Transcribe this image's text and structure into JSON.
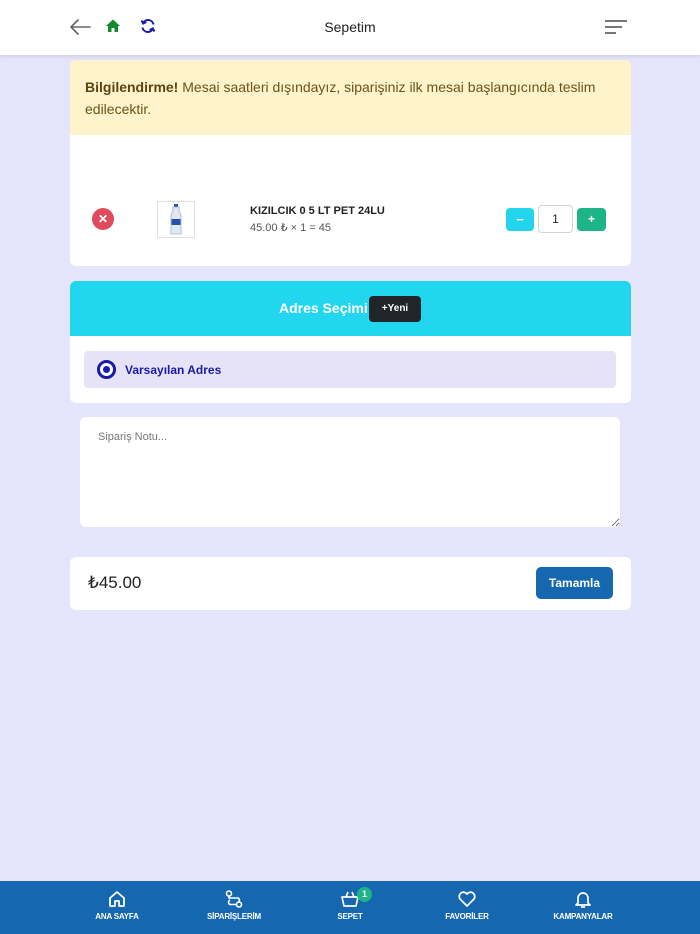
{
  "header": {
    "title": "Sepetim",
    "icons": [
      "arrow-left-icon",
      "home-icon",
      "refresh-icon",
      "menu-icon"
    ]
  },
  "alert": {
    "strong": "Bilgilendirme!",
    "text": "Mesai saatleri dışındayız, siparişiniz ilk mesai başlangıcında teslim edilecektir."
  },
  "cart": {
    "items": [
      {
        "name": "KIZILCIK 0 5 LT PET 24LU",
        "price_line": "45.00 ₺ × 1 = 45",
        "quantity": "1",
        "minus_label": "−",
        "plus_label": "+",
        "remove_label": "✕"
      }
    ]
  },
  "address": {
    "title": "Adres Seçimi",
    "new_button": "+Yeni",
    "options": [
      {
        "label": "Varsayılan Adres",
        "selected": true
      }
    ]
  },
  "note": {
    "placeholder": "Sipariş Notu..."
  },
  "summary": {
    "total": "₺45.00",
    "complete_button": "Tamamla"
  },
  "bottom_nav": {
    "items": [
      {
        "label": "ANA SAYFA",
        "icon": "home-icon"
      },
      {
        "label": "SİPARİŞLERİM",
        "icon": "route-icon"
      },
      {
        "label": "SEPET",
        "icon": "basket-icon",
        "badge": "1"
      },
      {
        "label": "FAVORİLER",
        "icon": "heart-icon"
      },
      {
        "label": "KAMPANYALAR",
        "icon": "bell-icon"
      }
    ]
  },
  "colors": {
    "background": "#e4e5fb",
    "alert_bg": "#fff3cc",
    "address_header": "#22d6ef",
    "primary": "#1567b0",
    "success": "#1db489",
    "danger": "#e04a5a",
    "radio": "#1a1aa8"
  }
}
